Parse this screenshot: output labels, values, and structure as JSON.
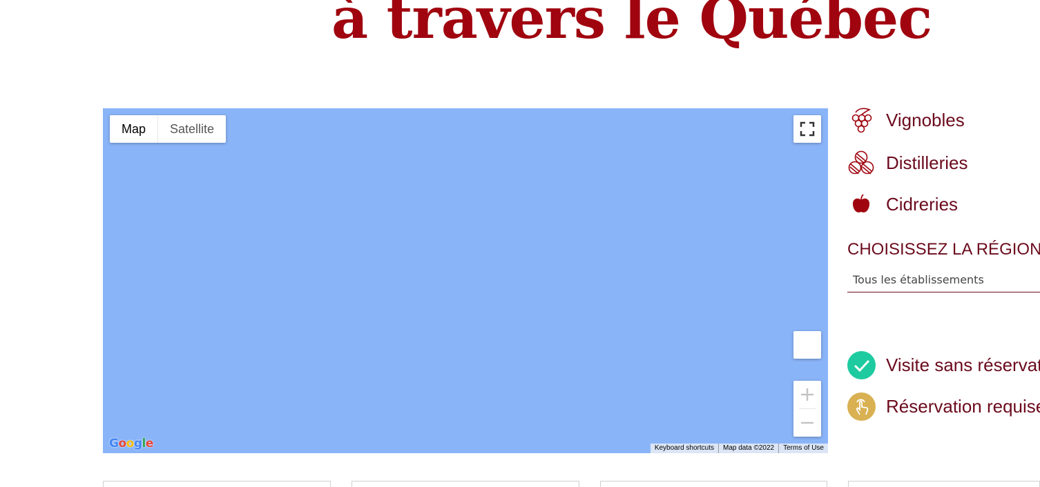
{
  "page": {
    "title": "à travers le Québec"
  },
  "map": {
    "map_type_buttons": [
      "Map",
      "Satellite"
    ],
    "active_map_type": "Map",
    "water_color": "#8ab4f8",
    "logo_text": "Google",
    "attribution": {
      "shortcuts": "Keyboard shortcuts",
      "data": "Map data ©2022",
      "terms": "Terms of Use"
    }
  },
  "categories": [
    {
      "label": "Vignobles",
      "icon": "grape-icon"
    },
    {
      "label": "Distilleries",
      "icon": "barrels-icon"
    },
    {
      "label": "Cidreries",
      "icon": "apple-icon"
    }
  ],
  "region": {
    "heading": "CHOISISSEZ LA RÉGION",
    "selected": "Tous les établissements"
  },
  "legend": [
    {
      "label": "Visite sans réservation",
      "icon": "check-icon",
      "color": "#1ecba0"
    },
    {
      "label": "Réservation requise",
      "icon": "tap-icon",
      "color": "#d9b152"
    }
  ],
  "colors": {
    "brand_red": "#a0040f",
    "text_maroon": "#6b0b1d"
  }
}
